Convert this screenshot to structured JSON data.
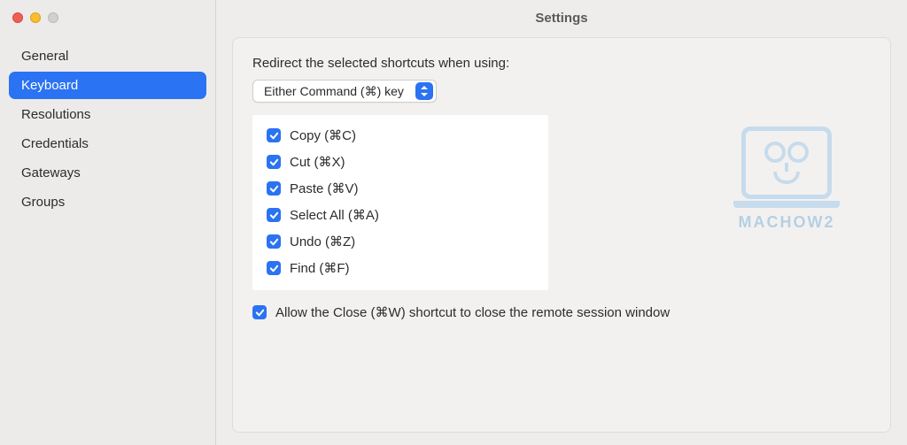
{
  "window": {
    "title": "Settings"
  },
  "sidebar": {
    "items": [
      {
        "label": "General",
        "selected": false
      },
      {
        "label": "Keyboard",
        "selected": true
      },
      {
        "label": "Resolutions",
        "selected": false
      },
      {
        "label": "Credentials",
        "selected": false
      },
      {
        "label": "Gateways",
        "selected": false
      },
      {
        "label": "Groups",
        "selected": false
      }
    ]
  },
  "panel": {
    "redirect_label": "Redirect the selected shortcuts when using:",
    "command_select": {
      "value": "Either Command (⌘) key"
    },
    "shortcuts": [
      {
        "label": "Copy (⌘C)",
        "checked": true
      },
      {
        "label": "Cut (⌘X)",
        "checked": true
      },
      {
        "label": "Paste (⌘V)",
        "checked": true
      },
      {
        "label": "Select All (⌘A)",
        "checked": true
      },
      {
        "label": "Undo (⌘Z)",
        "checked": true
      },
      {
        "label": "Find (⌘F)",
        "checked": true
      }
    ],
    "allow_close": {
      "label": "Allow the Close (⌘W) shortcut to close the remote session window",
      "checked": true
    }
  },
  "watermark": {
    "text": "MACHOW2"
  }
}
